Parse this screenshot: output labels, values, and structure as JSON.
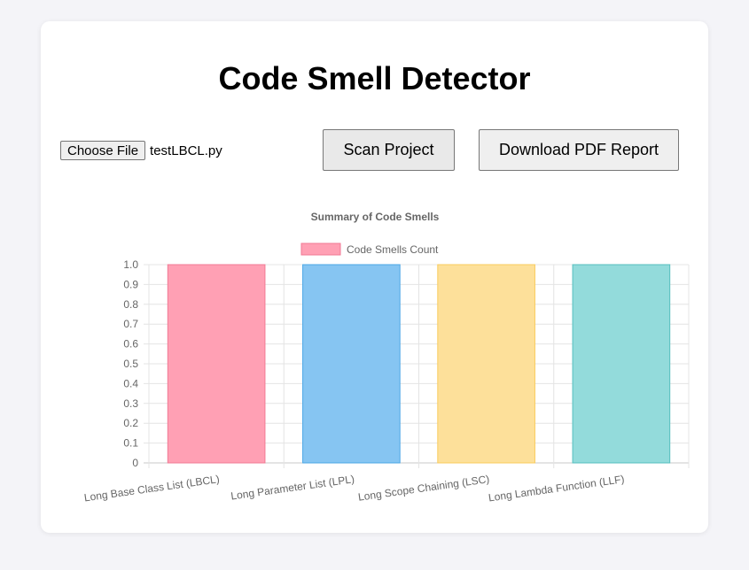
{
  "app": {
    "title": "Code Smell Detector"
  },
  "file_input": {
    "button_label": "Choose File",
    "selected_file": "testLBCL.py"
  },
  "actions": {
    "scan_label": "Scan Project",
    "download_label": "Download PDF Report"
  },
  "chart_data": {
    "type": "bar",
    "title": "Summary of Code Smells",
    "legend_position": "top",
    "grid": true,
    "ylim": [
      0,
      1.0
    ],
    "y_ticks": [
      "0",
      "0.1",
      "0.2",
      "0.3",
      "0.4",
      "0.5",
      "0.6",
      "0.7",
      "0.8",
      "0.9",
      "1.0"
    ],
    "categories": [
      "Long Base Class List (LBCL)",
      "Long Parameter List (LPL)",
      "Long Scope Chaining (LSC)",
      "Long Lambda Function (LLF)"
    ],
    "series": [
      {
        "name": "Code Smells Count",
        "values": [
          1,
          1,
          1,
          1
        ]
      }
    ],
    "bar_fill_colors": [
      "#ffa0b4",
      "#86c5f2",
      "#fde09a",
      "#93dbdb"
    ],
    "bar_border_colors": [
      "#f27a94",
      "#4ba7e6",
      "#f9cb5c",
      "#56bfbf"
    ]
  }
}
